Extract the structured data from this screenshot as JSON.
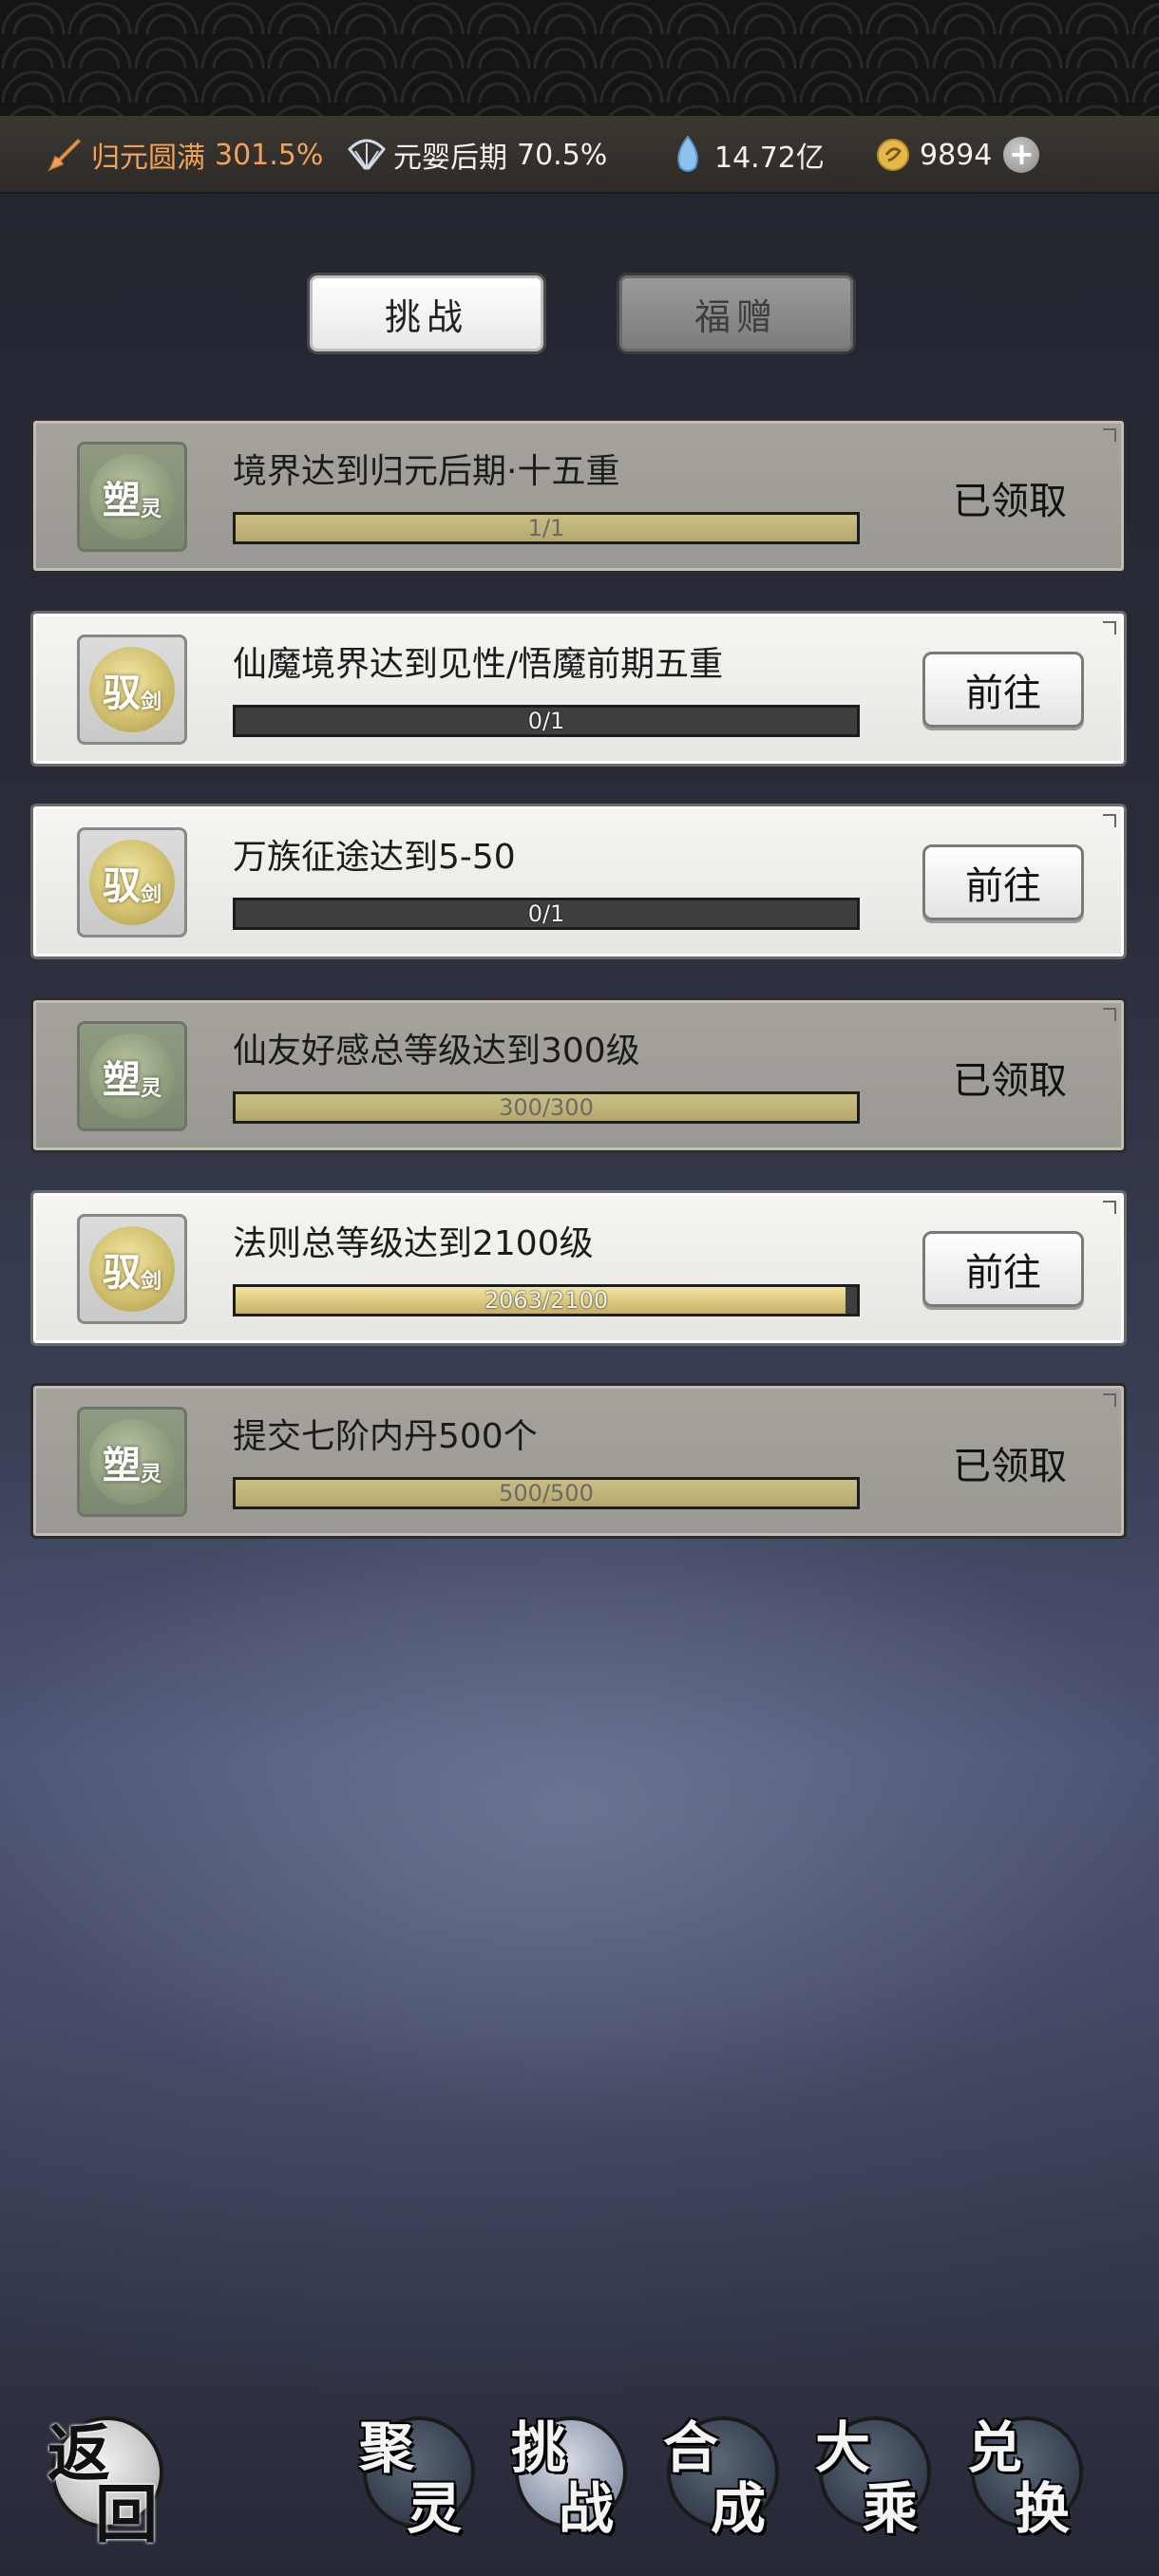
{
  "resources": {
    "cultivation": {
      "icon": "sword-icon",
      "name": "归元圆满",
      "value": "301.5%",
      "color": "#f3a25a"
    },
    "nascent": {
      "icon": "fan-icon",
      "name": "元婴后期",
      "value": "70.5%"
    },
    "spirit_stone": {
      "icon": "crystal-icon",
      "value": "14.72亿"
    },
    "currency": {
      "icon": "coin-icon",
      "value": "9894",
      "add_label": "+"
    }
  },
  "tabs": {
    "challenge": "挑战",
    "gift": "福赠"
  },
  "tasks": [
    {
      "icon_text": "塑",
      "icon_sub": "灵",
      "title": "境界达到归元后期·十五重",
      "progress": "1/1",
      "fraction": 1.0,
      "status": "已领取"
    },
    {
      "icon_text": "驭",
      "icon_sub": "剑",
      "title": "仙魔境界达到见性/悟魔前期五重",
      "progress": "0/1",
      "fraction": 0.0,
      "action": "前往"
    },
    {
      "icon_text": "驭",
      "icon_sub": "剑",
      "title": "万族征途达到5-50",
      "progress": "0/1",
      "fraction": 0.0,
      "action": "前往"
    },
    {
      "icon_text": "塑",
      "icon_sub": "灵",
      "title": "仙友好感总等级达到300级",
      "progress": "300/300",
      "fraction": 1.0,
      "status": "已领取"
    },
    {
      "icon_text": "驭",
      "icon_sub": "剑",
      "title": "法则总等级达到2100级",
      "progress": "2063/2100",
      "fraction": 0.982,
      "action": "前往"
    },
    {
      "icon_text": "塑",
      "icon_sub": "灵",
      "title": "提交七阶内丹500个",
      "progress": "500/500",
      "fraction": 1.0,
      "status": "已领取"
    }
  ],
  "nav": {
    "back": [
      "返",
      "回"
    ],
    "gather": [
      "聚",
      "灵"
    ],
    "challenge": [
      "挑",
      "战"
    ],
    "synthesize": [
      "合",
      "成"
    ],
    "dacheng": [
      "大",
      "乘"
    ],
    "exchange": [
      "兑",
      "换"
    ]
  }
}
